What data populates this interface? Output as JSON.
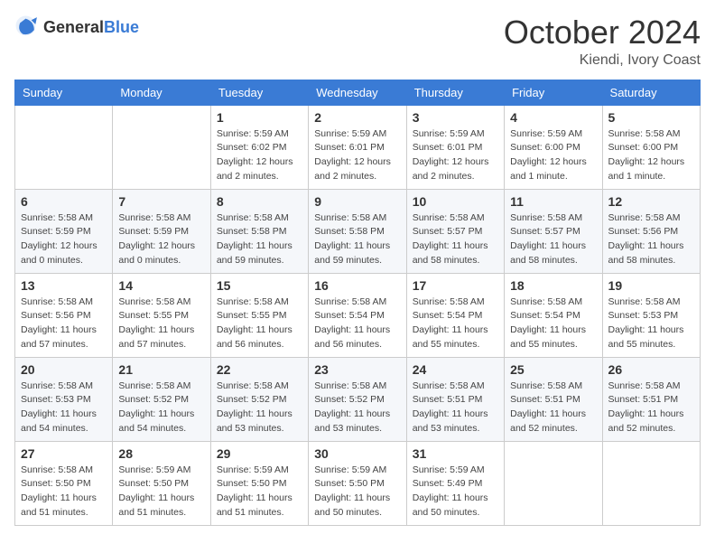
{
  "header": {
    "logo_general": "General",
    "logo_blue": "Blue",
    "month": "October 2024",
    "location": "Kiendi, Ivory Coast"
  },
  "weekdays": [
    "Sunday",
    "Monday",
    "Tuesday",
    "Wednesday",
    "Thursday",
    "Friday",
    "Saturday"
  ],
  "weeks": [
    [
      null,
      null,
      {
        "day": "1",
        "sunrise": "Sunrise: 5:59 AM",
        "sunset": "Sunset: 6:02 PM",
        "daylight": "Daylight: 12 hours and 2 minutes."
      },
      {
        "day": "2",
        "sunrise": "Sunrise: 5:59 AM",
        "sunset": "Sunset: 6:01 PM",
        "daylight": "Daylight: 12 hours and 2 minutes."
      },
      {
        "day": "3",
        "sunrise": "Sunrise: 5:59 AM",
        "sunset": "Sunset: 6:01 PM",
        "daylight": "Daylight: 12 hours and 2 minutes."
      },
      {
        "day": "4",
        "sunrise": "Sunrise: 5:59 AM",
        "sunset": "Sunset: 6:00 PM",
        "daylight": "Daylight: 12 hours and 1 minute."
      },
      {
        "day": "5",
        "sunrise": "Sunrise: 5:58 AM",
        "sunset": "Sunset: 6:00 PM",
        "daylight": "Daylight: 12 hours and 1 minute."
      }
    ],
    [
      {
        "day": "6",
        "sunrise": "Sunrise: 5:58 AM",
        "sunset": "Sunset: 5:59 PM",
        "daylight": "Daylight: 12 hours and 0 minutes."
      },
      {
        "day": "7",
        "sunrise": "Sunrise: 5:58 AM",
        "sunset": "Sunset: 5:59 PM",
        "daylight": "Daylight: 12 hours and 0 minutes."
      },
      {
        "day": "8",
        "sunrise": "Sunrise: 5:58 AM",
        "sunset": "Sunset: 5:58 PM",
        "daylight": "Daylight: 11 hours and 59 minutes."
      },
      {
        "day": "9",
        "sunrise": "Sunrise: 5:58 AM",
        "sunset": "Sunset: 5:58 PM",
        "daylight": "Daylight: 11 hours and 59 minutes."
      },
      {
        "day": "10",
        "sunrise": "Sunrise: 5:58 AM",
        "sunset": "Sunset: 5:57 PM",
        "daylight": "Daylight: 11 hours and 58 minutes."
      },
      {
        "day": "11",
        "sunrise": "Sunrise: 5:58 AM",
        "sunset": "Sunset: 5:57 PM",
        "daylight": "Daylight: 11 hours and 58 minutes."
      },
      {
        "day": "12",
        "sunrise": "Sunrise: 5:58 AM",
        "sunset": "Sunset: 5:56 PM",
        "daylight": "Daylight: 11 hours and 58 minutes."
      }
    ],
    [
      {
        "day": "13",
        "sunrise": "Sunrise: 5:58 AM",
        "sunset": "Sunset: 5:56 PM",
        "daylight": "Daylight: 11 hours and 57 minutes."
      },
      {
        "day": "14",
        "sunrise": "Sunrise: 5:58 AM",
        "sunset": "Sunset: 5:55 PM",
        "daylight": "Daylight: 11 hours and 57 minutes."
      },
      {
        "day": "15",
        "sunrise": "Sunrise: 5:58 AM",
        "sunset": "Sunset: 5:55 PM",
        "daylight": "Daylight: 11 hours and 56 minutes."
      },
      {
        "day": "16",
        "sunrise": "Sunrise: 5:58 AM",
        "sunset": "Sunset: 5:54 PM",
        "daylight": "Daylight: 11 hours and 56 minutes."
      },
      {
        "day": "17",
        "sunrise": "Sunrise: 5:58 AM",
        "sunset": "Sunset: 5:54 PM",
        "daylight": "Daylight: 11 hours and 55 minutes."
      },
      {
        "day": "18",
        "sunrise": "Sunrise: 5:58 AM",
        "sunset": "Sunset: 5:54 PM",
        "daylight": "Daylight: 11 hours and 55 minutes."
      },
      {
        "day": "19",
        "sunrise": "Sunrise: 5:58 AM",
        "sunset": "Sunset: 5:53 PM",
        "daylight": "Daylight: 11 hours and 55 minutes."
      }
    ],
    [
      {
        "day": "20",
        "sunrise": "Sunrise: 5:58 AM",
        "sunset": "Sunset: 5:53 PM",
        "daylight": "Daylight: 11 hours and 54 minutes."
      },
      {
        "day": "21",
        "sunrise": "Sunrise: 5:58 AM",
        "sunset": "Sunset: 5:52 PM",
        "daylight": "Daylight: 11 hours and 54 minutes."
      },
      {
        "day": "22",
        "sunrise": "Sunrise: 5:58 AM",
        "sunset": "Sunset: 5:52 PM",
        "daylight": "Daylight: 11 hours and 53 minutes."
      },
      {
        "day": "23",
        "sunrise": "Sunrise: 5:58 AM",
        "sunset": "Sunset: 5:52 PM",
        "daylight": "Daylight: 11 hours and 53 minutes."
      },
      {
        "day": "24",
        "sunrise": "Sunrise: 5:58 AM",
        "sunset": "Sunset: 5:51 PM",
        "daylight": "Daylight: 11 hours and 53 minutes."
      },
      {
        "day": "25",
        "sunrise": "Sunrise: 5:58 AM",
        "sunset": "Sunset: 5:51 PM",
        "daylight": "Daylight: 11 hours and 52 minutes."
      },
      {
        "day": "26",
        "sunrise": "Sunrise: 5:58 AM",
        "sunset": "Sunset: 5:51 PM",
        "daylight": "Daylight: 11 hours and 52 minutes."
      }
    ],
    [
      {
        "day": "27",
        "sunrise": "Sunrise: 5:58 AM",
        "sunset": "Sunset: 5:50 PM",
        "daylight": "Daylight: 11 hours and 51 minutes."
      },
      {
        "day": "28",
        "sunrise": "Sunrise: 5:59 AM",
        "sunset": "Sunset: 5:50 PM",
        "daylight": "Daylight: 11 hours and 51 minutes."
      },
      {
        "day": "29",
        "sunrise": "Sunrise: 5:59 AM",
        "sunset": "Sunset: 5:50 PM",
        "daylight": "Daylight: 11 hours and 51 minutes."
      },
      {
        "day": "30",
        "sunrise": "Sunrise: 5:59 AM",
        "sunset": "Sunset: 5:50 PM",
        "daylight": "Daylight: 11 hours and 50 minutes."
      },
      {
        "day": "31",
        "sunrise": "Sunrise: 5:59 AM",
        "sunset": "Sunset: 5:49 PM",
        "daylight": "Daylight: 11 hours and 50 minutes."
      },
      null,
      null
    ]
  ]
}
